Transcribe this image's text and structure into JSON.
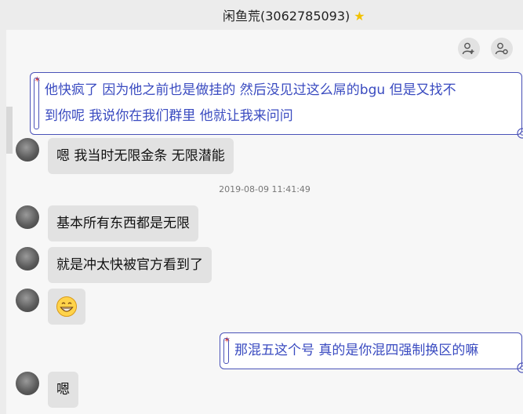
{
  "window": {
    "title": "闲鱼荒(3062785093)"
  },
  "header_buttons": [
    {
      "name": "add-member-icon"
    },
    {
      "name": "member-settings-icon"
    }
  ],
  "messages": [
    {
      "side": "right",
      "lines": [
        "他快疯了 因为他之前也是做挂的 然后没见过这么屌的bgu 但是又找不",
        "到你呢 我说你在我们群里 他就让我来问问"
      ]
    },
    {
      "side": "left",
      "text": "嗯 我当时无限金条 无限潜能"
    },
    {
      "side": "timestamp",
      "text": "2019-08-09 11:41:49"
    },
    {
      "side": "left",
      "text": "基本所有东西都是无限"
    },
    {
      "side": "left",
      "text": "就是冲太快被官方看到了"
    },
    {
      "side": "left",
      "emoji": "grin-emoji"
    },
    {
      "side": "right",
      "lines": [
        "那混五这个号 真的是你混四强制换区的嘛"
      ]
    },
    {
      "side": "left",
      "text": "嗯"
    }
  ],
  "colors": {
    "self_bubble_border": "#4a52b8",
    "self_text": "#3a4bc0",
    "other_bubble": "#e2e2e2"
  }
}
